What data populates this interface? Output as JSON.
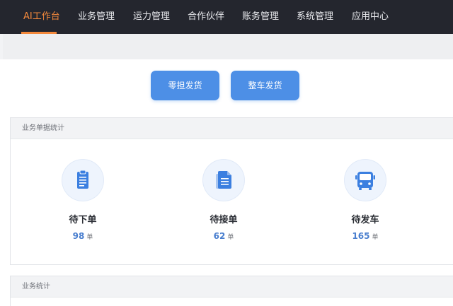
{
  "nav": {
    "items": [
      {
        "label": "AI工作台",
        "active": true
      },
      {
        "label": "业务管理"
      },
      {
        "label": "运力管理"
      },
      {
        "label": "合作伙伴"
      },
      {
        "label": "账务管理"
      },
      {
        "label": "系统管理"
      },
      {
        "label": "应用中心"
      }
    ]
  },
  "actions": {
    "ltl_label": "零担发货",
    "ftl_label": "整车发货"
  },
  "order_stats": {
    "title": "业务单据统计",
    "items": [
      {
        "icon": "clipboard-icon",
        "label": "待下单",
        "count": "98",
        "unit": "单"
      },
      {
        "icon": "document-icon",
        "label": "待接单",
        "count": "62",
        "unit": "单"
      },
      {
        "icon": "bus-icon",
        "label": "待发车",
        "count": "165",
        "unit": "单"
      }
    ]
  },
  "business_stats": {
    "title": "业务统计"
  },
  "colors": {
    "nav_bg": "#24262e",
    "accent": "#f4893c",
    "primary": "#4d8fe6"
  }
}
